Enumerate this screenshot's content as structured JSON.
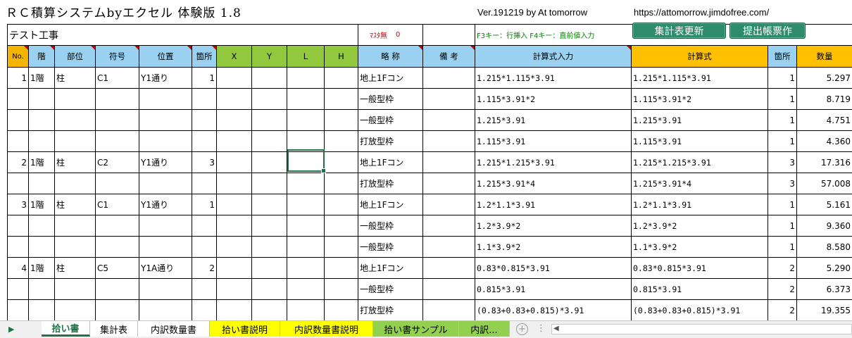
{
  "header": {
    "title": "ＲＣ積算システムbyエクセル 体験版 1.8",
    "version": "Ver.191219  by At tomorrow",
    "url": "https://attomorrow.jimdofree.com/"
  },
  "info_row": {
    "project_name": "テスト工事",
    "mask_label": "ﾏｽﾀ無",
    "mask_count": "0",
    "key_hint": "F3キー：行挿入 F4キー：直前値入力"
  },
  "buttons": {
    "summary_update": "集計表更新",
    "submit_form": "提出帳票作"
  },
  "columns": [
    "No.",
    "階",
    "部位",
    "符号",
    "位置",
    "箇所",
    "X",
    "Y",
    "L",
    "H",
    "略 称",
    "備 考",
    "計算式入力",
    "計算式",
    "箇所",
    "数量"
  ],
  "rows": [
    {
      "no": "1",
      "floor": "1階",
      "part": "柱",
      "code": "C1",
      "position": "Y1通り",
      "count": "1",
      "x": "",
      "y": "",
      "l": "",
      "h": "",
      "abbr": "地上1Fコン",
      "note": "",
      "formula_input": "1.215*1.115*3.91",
      "formula": "1.215*1.115*3.91",
      "qty_count": "1",
      "quantity": "5.297"
    },
    {
      "no": "",
      "floor": "",
      "part": "",
      "code": "",
      "position": "",
      "count": "",
      "x": "",
      "y": "",
      "l": "",
      "h": "",
      "abbr": "一般型枠",
      "note": "",
      "formula_input": "1.115*3.91*2",
      "formula": "1.115*3.91*2",
      "qty_count": "1",
      "quantity": "8.719"
    },
    {
      "no": "",
      "floor": "",
      "part": "",
      "code": "",
      "position": "",
      "count": "",
      "x": "",
      "y": "",
      "l": "",
      "h": "",
      "abbr": "一般型枠",
      "note": "",
      "formula_input": "1.215*3.91",
      "formula": "1.215*3.91",
      "qty_count": "1",
      "quantity": "4.751"
    },
    {
      "no": "",
      "floor": "",
      "part": "",
      "code": "",
      "position": "",
      "count": "",
      "x": "",
      "y": "",
      "l": "",
      "h": "",
      "abbr": "打放型枠",
      "note": "",
      "formula_input": "1.115*3.91",
      "formula": "1.115*3.91",
      "qty_count": "1",
      "quantity": "4.360"
    },
    {
      "no": "2",
      "floor": "1階",
      "part": "柱",
      "code": "C2",
      "position": "Y1通り",
      "count": "3",
      "x": "",
      "y": "",
      "l": "",
      "h": "",
      "abbr": "地上1Fコン",
      "note": "",
      "formula_input": "1.215*1.215*3.91",
      "formula": "1.215*1.215*3.91",
      "qty_count": "3",
      "quantity": "17.316"
    },
    {
      "no": "",
      "floor": "",
      "part": "",
      "code": "",
      "position": "",
      "count": "",
      "x": "",
      "y": "",
      "l": "",
      "h": "",
      "abbr": "打放型枠",
      "note": "",
      "formula_input": "1.215*3.91*4",
      "formula": "1.215*3.91*4",
      "qty_count": "3",
      "quantity": "57.008"
    },
    {
      "no": "3",
      "floor": "1階",
      "part": "柱",
      "code": "C1",
      "position": "Y1通り",
      "count": "1",
      "x": "",
      "y": "",
      "l": "",
      "h": "",
      "abbr": "地上1Fコン",
      "note": "",
      "formula_input": "1.2*1.1*3.91",
      "formula": "1.2*1.1*3.91",
      "qty_count": "1",
      "quantity": "5.161"
    },
    {
      "no": "",
      "floor": "",
      "part": "",
      "code": "",
      "position": "",
      "count": "",
      "x": "",
      "y": "",
      "l": "",
      "h": "",
      "abbr": "一般型枠",
      "note": "",
      "formula_input": "1.2*3.9*2",
      "formula": "1.2*3.9*2",
      "qty_count": "1",
      "quantity": "9.360"
    },
    {
      "no": "",
      "floor": "",
      "part": "",
      "code": "",
      "position": "",
      "count": "",
      "x": "",
      "y": "",
      "l": "",
      "h": "",
      "abbr": "一般型枠",
      "note": "",
      "formula_input": "1.1*3.9*2",
      "formula": "1.1*3.9*2",
      "qty_count": "1",
      "quantity": "8.580"
    },
    {
      "no": "4",
      "floor": "1階",
      "part": "柱",
      "code": "C5",
      "position": "Y1A通り",
      "count": "2",
      "x": "",
      "y": "",
      "l": "",
      "h": "",
      "abbr": "地上1Fコン",
      "note": "",
      "formula_input": "0.83*0.815*3.91",
      "formula": "0.83*0.815*3.91",
      "qty_count": "2",
      "quantity": "5.290"
    },
    {
      "no": "",
      "floor": "",
      "part": "",
      "code": "",
      "position": "",
      "count": "",
      "x": "",
      "y": "",
      "l": "",
      "h": "",
      "abbr": "一般型枠",
      "note": "",
      "formula_input": "0.815*3.91",
      "formula": "0.815*3.91",
      "qty_count": "2",
      "quantity": "6.373"
    },
    {
      "no": "",
      "floor": "",
      "part": "",
      "code": "",
      "position": "",
      "count": "",
      "x": "",
      "y": "",
      "l": "",
      "h": "",
      "abbr": "打放型枠",
      "note": "",
      "formula_input": "(0.83+0.83+0.815)*3.91",
      "formula": "(0.83+0.83+0.815)*3.91",
      "qty_count": "2",
      "quantity": "19.355"
    }
  ],
  "sheet_tabs": [
    "拾い書",
    "集計表",
    "内訳数量書",
    "拾い書説明",
    "内訳数量書説明",
    "拾い書サンプル",
    "内訳..."
  ],
  "active_tab": "拾い書",
  "icons": {
    "tab_scroll": "triangle-right-icon",
    "new_sheet": "plus-circle-icon",
    "more": "vertical-dots-icon",
    "scroll_left": "triangle-left-icon"
  },
  "colors": {
    "header_orange": "#f5b400",
    "header_blue": "#9ad0f0",
    "header_green": "#92c83e",
    "header_yellow": "#ffc000",
    "button_green": "#2e8b6c",
    "tab_yellow": "#ffff00",
    "tab_green": "#92d050",
    "selection": "#217346"
  }
}
